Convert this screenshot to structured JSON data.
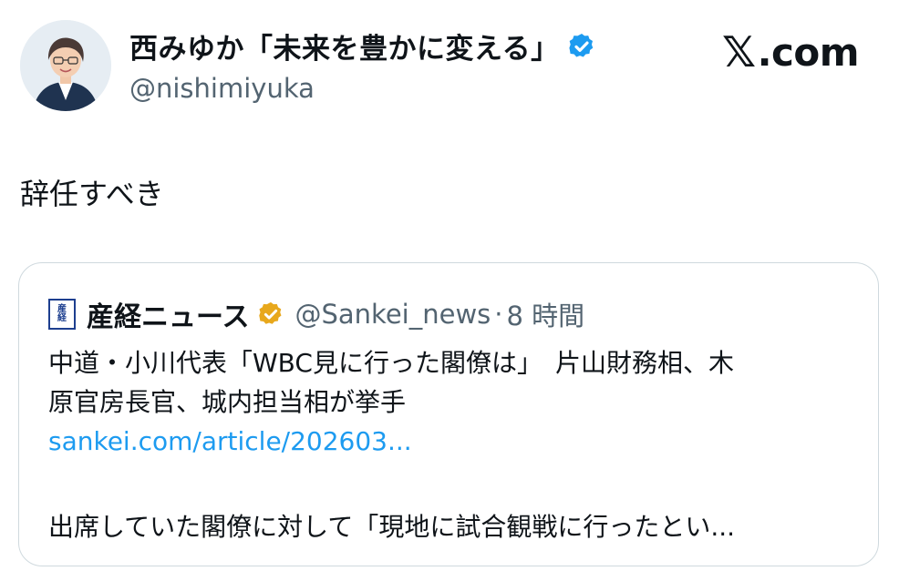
{
  "author": {
    "display_name": "西みゆか「未来を豊かに変える」",
    "handle": "@nishimiyuka",
    "avatar_icon": "avatar-photo",
    "verified_icon": "verified-badge-icon",
    "verified_color": "#1d9bf0"
  },
  "brand": {
    "x_glyph": "𝕏",
    "domain": ".com"
  },
  "tweet": {
    "text": "辞任すべき"
  },
  "quoted_tweet": {
    "logo_chars": [
      "産",
      "経"
    ],
    "name": "産経ニュース",
    "verified_icon": "gold-verified-badge-icon",
    "verified_color": "#e8a81c",
    "handle": "@Sankei_news",
    "separator": "·",
    "time": "8 時間",
    "headline_line1": "中道・小川代表「WBC見に行った閣僚は」　片山財務相、木",
    "headline_line2": "原官房長官、城内担当相が挙手",
    "link": "sankei.com/article/202603...",
    "snippet": "出席していた閣僚に対して「現地に試合観戦に行ったとい..."
  },
  "colors": {
    "text_primary": "#0f1419",
    "text_secondary": "#536471",
    "link": "#1d9bf0",
    "card_border": "#cfd9de"
  }
}
